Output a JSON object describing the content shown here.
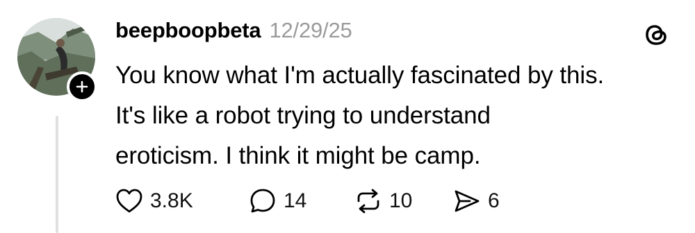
{
  "post": {
    "username": "beepboopbeta",
    "timestamp": "12/29/25",
    "text_lines": [
      "You know what I'm actually fascinated by this.",
      "It's like a robot trying to understand",
      "eroticism. I think it might be camp."
    ],
    "actions": {
      "likes": "3.8K",
      "comments": "14",
      "reposts": "10",
      "shares": "6"
    }
  },
  "icons": {
    "avatar": "avatar-photo",
    "follow": "plus-icon",
    "brand": "threads-logo-icon",
    "like": "heart-icon",
    "comment": "comment-bubble-icon",
    "repost": "repost-icon",
    "share": "send-icon"
  },
  "colors": {
    "text": "#000000",
    "muted": "#9a9a9a",
    "thread_line": "#e0e0e0",
    "background": "#ffffff"
  }
}
